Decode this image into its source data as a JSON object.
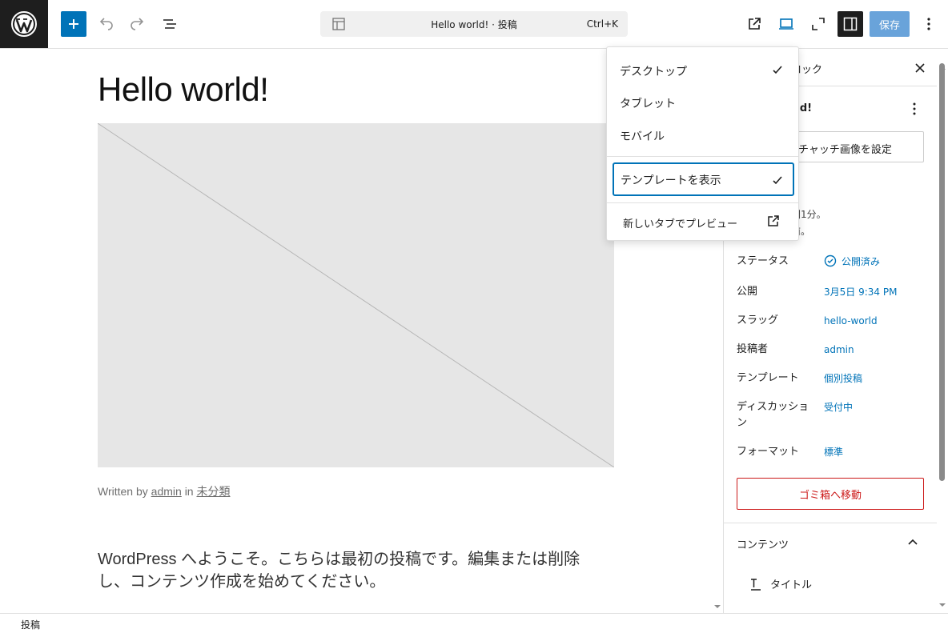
{
  "toolbar": {
    "logo": "wordpress-logo",
    "add_block_icon": "plus-icon",
    "undo_icon": "undo-icon",
    "redo_icon": "redo-icon",
    "list_view_icon": "list-view-icon",
    "command_title": "Hello world! · 投稿",
    "command_shortcut": "Ctrl+K",
    "save_label": "保存",
    "accent": "#0073b8"
  },
  "canvas": {
    "title": "Hello world!",
    "meta_prefix": "Written by",
    "meta_author": "admin",
    "meta_in": "in",
    "meta_category": "未分類",
    "body": "WordPress へようこそ。こちらは最初の投稿です。編集または削除し、コンテンツ作成を始めてください。"
  },
  "dropdown": {
    "items": [
      {
        "label": "デスクトップ",
        "checked": true
      },
      {
        "label": "タブレット",
        "checked": false
      },
      {
        "label": "モバイル",
        "checked": false
      }
    ],
    "show_template": "テンプレートを表示",
    "preview_new_tab": "新しいタブでプレビュー"
  },
  "sidebar": {
    "tab_label": "ロック",
    "post_title": "rld!",
    "featured_image_button": "チャッチ画像を設定",
    "read_time": "間1分。",
    "last_edit": "前。",
    "rows": [
      {
        "label": "ステータス",
        "value": "公開済み"
      },
      {
        "label": "公開",
        "value": "3月5日 9:34 PM"
      },
      {
        "label": "スラッグ",
        "value": "hello-world"
      },
      {
        "label": "投稿者",
        "value": "admin"
      },
      {
        "label": "テンプレート",
        "value": "個別投稿"
      },
      {
        "label": "ディスカッション",
        "value": "受付中"
      },
      {
        "label": "フォーマット",
        "value": "標準"
      }
    ],
    "trash_button": "ゴミ箱へ移動",
    "content_heading": "コンテンツ",
    "content_item": "タイトル"
  },
  "statusbar": {
    "breadcrumb": "投稿"
  }
}
